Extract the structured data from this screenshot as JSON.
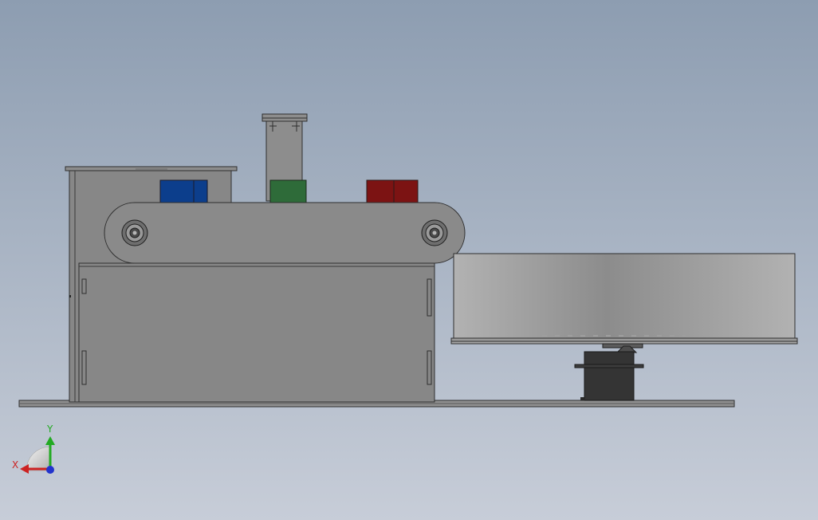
{
  "viewport": {
    "background_top": "#8d9db1",
    "background_bottom": "#c7cdd8",
    "body_gray": "#878787",
    "edge_color": "#2f2f2f",
    "belt_gray": "#8a8a8a",
    "base_gray": "#8f8f8f",
    "tray_light": "#b2b2b2",
    "tray_mid": "#8c8c8c",
    "servo_color": "#343434"
  },
  "blocks": {
    "blue": "#0c3e8c",
    "green": "#2e6b39",
    "red": "#7c1313"
  },
  "triad": {
    "x_label": "X",
    "y_label": "Y",
    "x_color": "#cc2222",
    "y_color": "#22aa22",
    "z_color": "#2233cc"
  }
}
